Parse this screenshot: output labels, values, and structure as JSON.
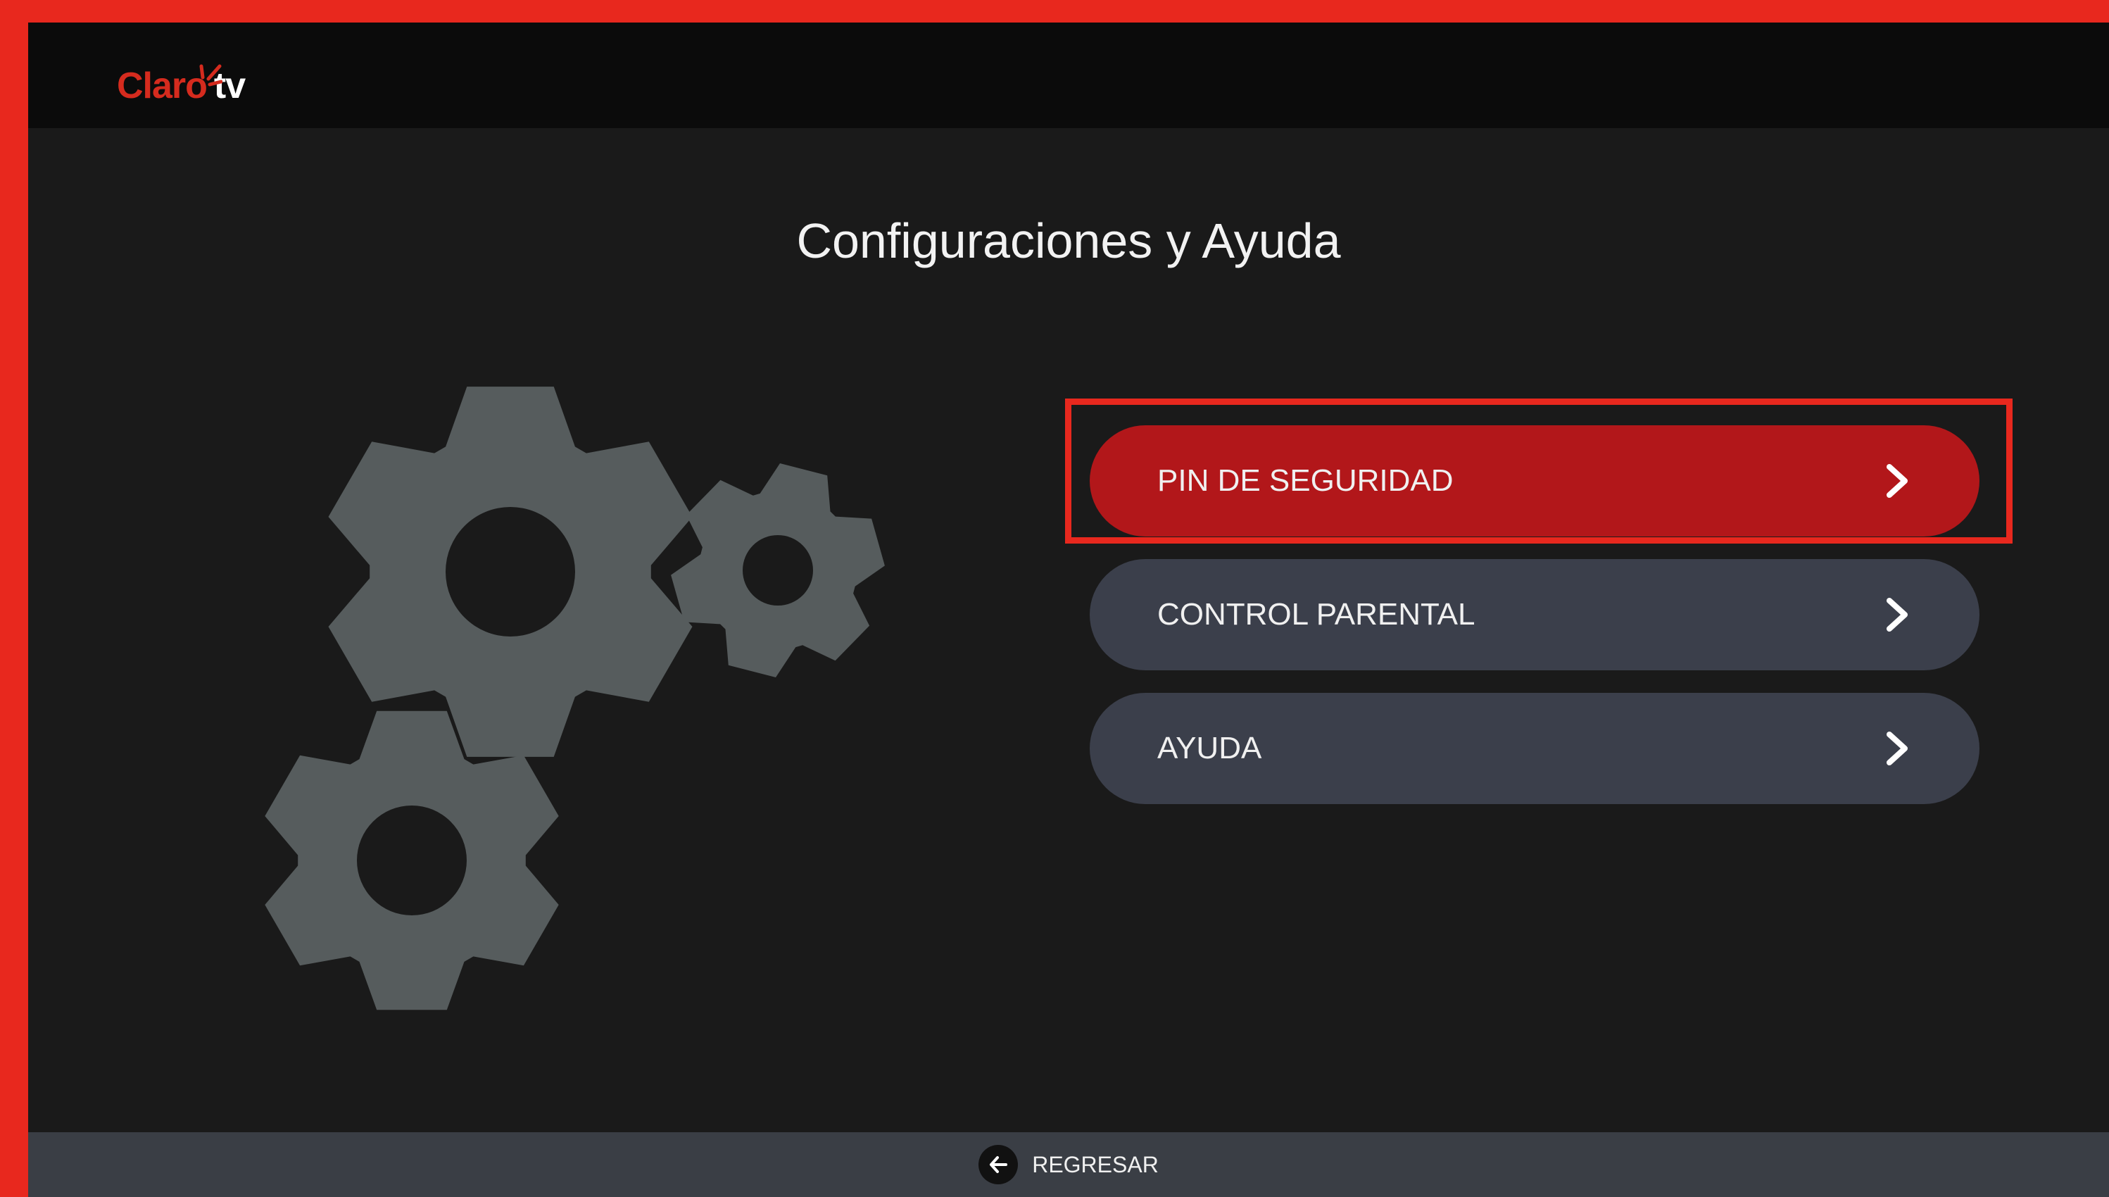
{
  "header": {
    "logo_brand": "Claro",
    "logo_suffix": "tv"
  },
  "page": {
    "title": "Configuraciones y Ayuda"
  },
  "menu": {
    "items": [
      {
        "label": "PIN DE SEGURIDAD",
        "selected": true
      },
      {
        "label": "CONTROL PARENTAL",
        "selected": false
      },
      {
        "label": "AYUDA",
        "selected": false
      }
    ]
  },
  "footer": {
    "back_label": "REGRESAR"
  },
  "icons": {
    "illustration": "gears-icon",
    "chevron": "chevron-right-icon",
    "back": "arrow-left-icon"
  },
  "colors": {
    "brand": "#d52b1e",
    "selected_item": "#b2171a",
    "menu_item": "#3b3f4b",
    "background": "#1a1a1a",
    "highlight_border": "#e8281e",
    "gear": "#565c5d"
  }
}
